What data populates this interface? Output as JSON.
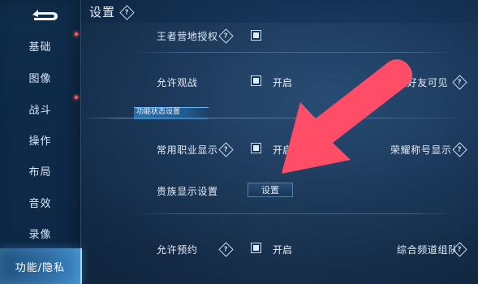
{
  "header": {
    "title": "设置",
    "help_icon": "?"
  },
  "sidebar": {
    "back_icon": "back-arrow-icon",
    "items": [
      {
        "label": "基础",
        "has_red_dot": true
      },
      {
        "label": "图像",
        "has_red_dot": false
      },
      {
        "label": "战斗",
        "has_red_dot": true
      },
      {
        "label": "操作",
        "has_red_dot": false
      },
      {
        "label": "布局",
        "has_red_dot": false
      },
      {
        "label": "音效",
        "has_red_dot": false
      },
      {
        "label": "录像",
        "has_red_dot": false
      },
      {
        "label": "功能/隐私",
        "active": true
      }
    ]
  },
  "main": {
    "rows": {
      "king_auth_label": "王者营地授权",
      "allow_spectate_label": "允许观战",
      "allow_spectate_toggle": "开启",
      "open_friend_visible_label": "放好友可见",
      "section_tab_label": "功能状态设置",
      "common_job_label": "常用职业显示",
      "common_job_toggle": "开启",
      "honor_title_label": "荣耀称号显示",
      "noble_display_label": "贵族显示设置",
      "noble_display_button": "设置",
      "allow_reserve_label": "允许预约",
      "allow_reserve_toggle": "开启",
      "general_channel_team_label": "综合频道组队"
    }
  },
  "colors": {
    "accent_blue": "#3c86c3",
    "annotation_red": "#ff4d67",
    "background_dark": "#0d2440"
  }
}
